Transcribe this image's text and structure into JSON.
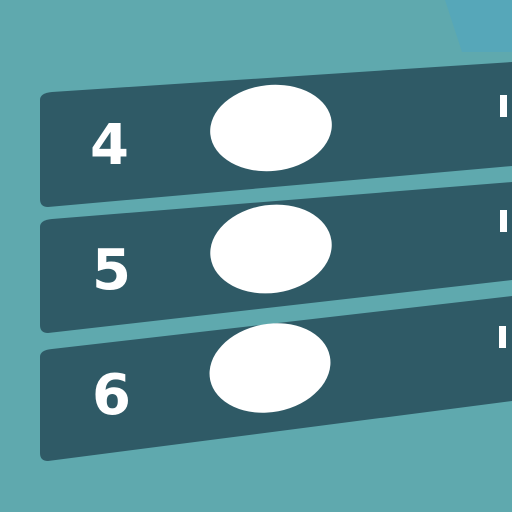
{
  "screen": {
    "background_color": "#5fa9ae",
    "panel_color": "#2f5a66",
    "accent_corner_color": "#56a7b9",
    "blob_color": "#ffffff",
    "text_color": "#ffffff"
  },
  "rows": [
    {
      "number": "4",
      "icon": "white-oval-icon"
    },
    {
      "number": "5",
      "icon": "white-oval-icon"
    },
    {
      "number": "6",
      "icon": "white-oval-icon"
    }
  ]
}
